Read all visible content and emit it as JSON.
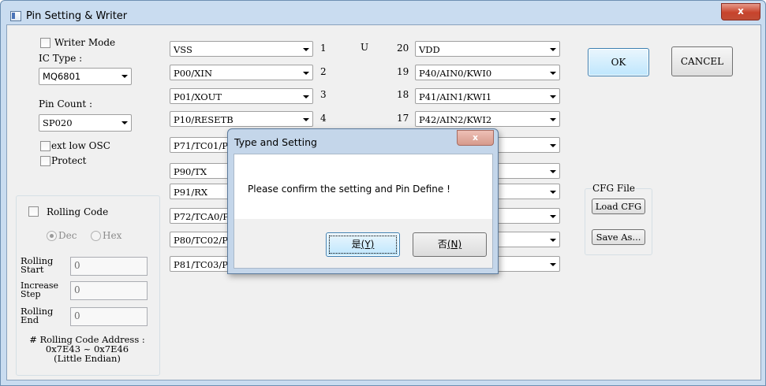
{
  "window": {
    "title": "Pin Setting & Writer",
    "close_glyph": "x"
  },
  "left": {
    "writer_mode": "Writer Mode",
    "ic_type_label": "IC Type :",
    "ic_type_value": "MQ6801",
    "pin_count_label": "Pin Count :",
    "pin_count_value": "SP020",
    "ext_low_osc": "ext low OSC",
    "protect": "Protect"
  },
  "rolling": {
    "title": "Rolling Code",
    "dec": "Dec",
    "hex": "Hex",
    "start_label_1": "Rolling",
    "start_label_2": "Start",
    "start_value": "0",
    "inc_label_1": "Increase",
    "inc_label_2": "Step",
    "inc_value": "0",
    "end_label_1": "Rolling",
    "end_label_2": "End",
    "end_value": "0",
    "addr_line1": "# Rolling Code Address :",
    "addr_line2": "0x7E43 ~ 0x7E46",
    "addr_line3": "(Little Endian)"
  },
  "pins_left": [
    "VSS",
    "P00/XIN",
    "P01/XOUT",
    "P10/RESETB",
    "P71/TC01/PWM",
    "P90/TX",
    "P91/RX",
    "P72/TCA0/PPG",
    "P80/TC02/PWM",
    "P81/TC03/PWM"
  ],
  "pin_numbers_left": [
    "1",
    "2",
    "3",
    "4"
  ],
  "chip_mark": "U",
  "pin_numbers_right": [
    "20",
    "19",
    "18",
    "17"
  ],
  "pins_right": [
    "VDD",
    "P40/AIN0/KWI0",
    "P41/AIN1/KWI1",
    "P42/AIN2/KWI2",
    "",
    "",
    "",
    "",
    "",
    ""
  ],
  "buttons": {
    "ok": "OK",
    "cancel": "CANCEL"
  },
  "cfg": {
    "title": "CFG File",
    "load": "Load CFG",
    "save": "Save As..."
  },
  "dialog": {
    "title": "Type and Setting",
    "close_glyph": "x",
    "message": "Please confirm the setting and Pin Define !",
    "yes": "是",
    "yes_key": "(Y)",
    "no": "否",
    "no_key": "(N)"
  }
}
